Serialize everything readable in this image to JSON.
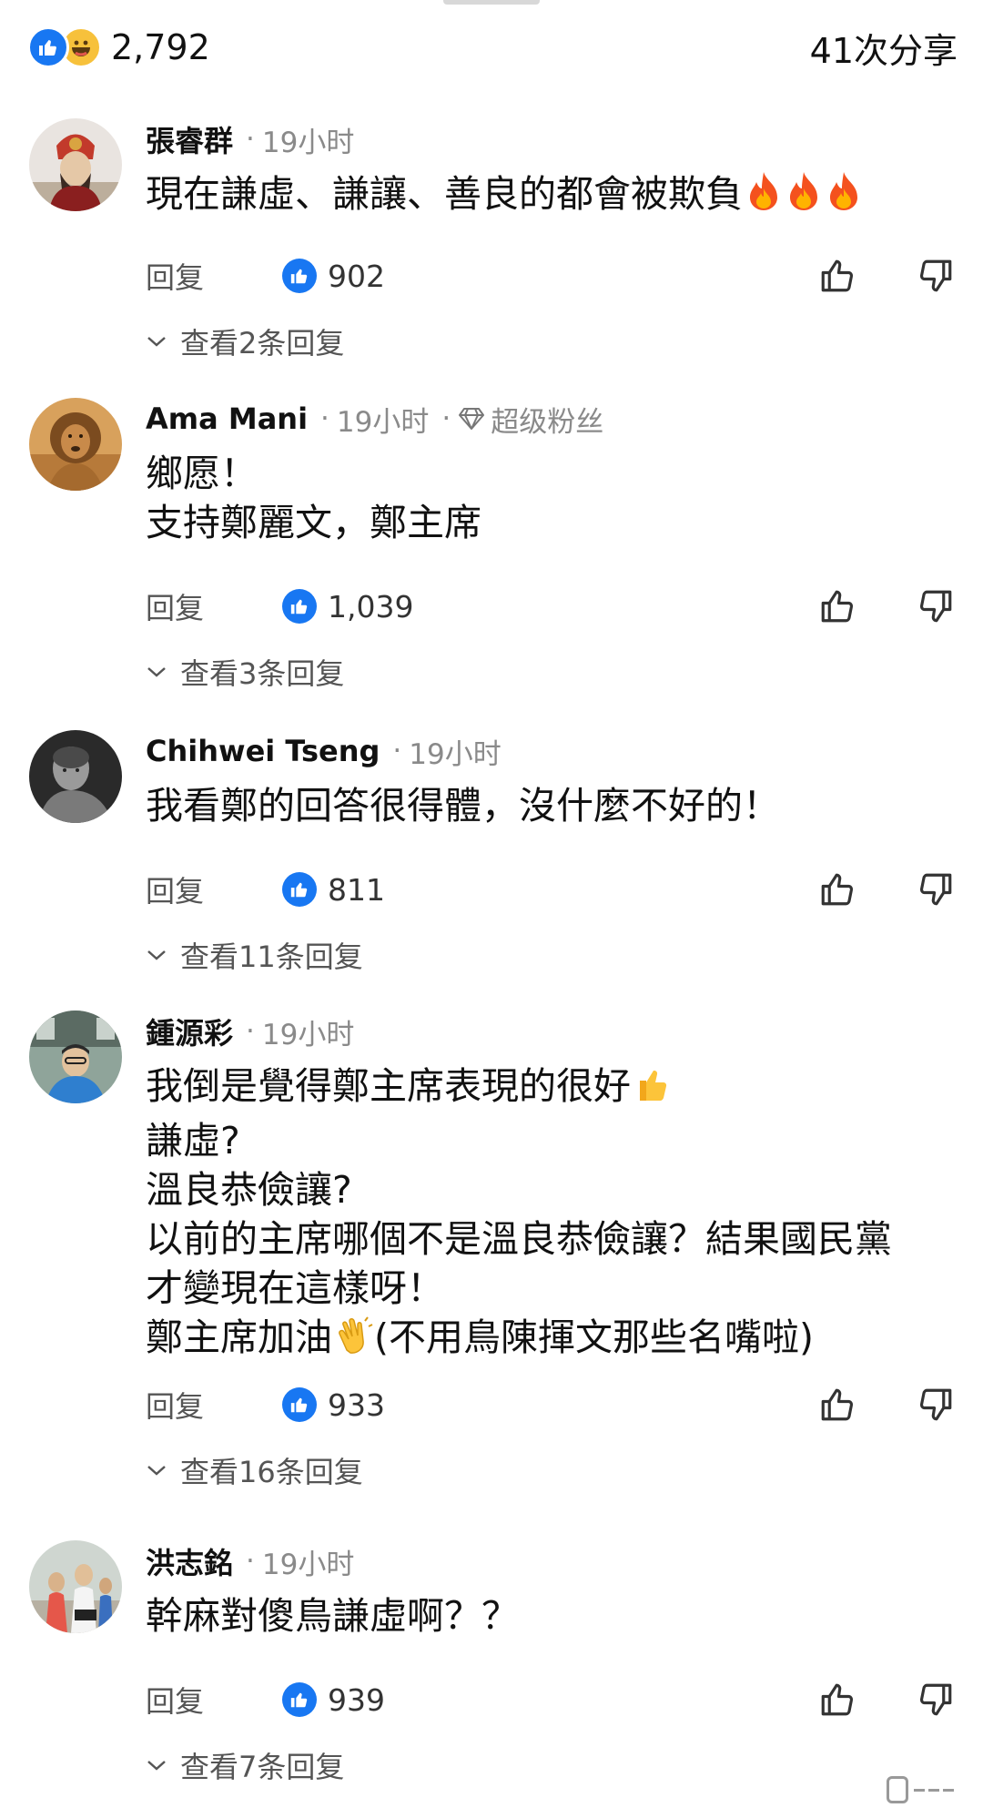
{
  "header": {
    "reaction_count": "2,792",
    "share_count": "41次分享",
    "reaction_icons": [
      "like-icon",
      "haha-icon"
    ]
  },
  "comments": [
    {
      "author": "張睿群",
      "time": "19小时",
      "badge": "",
      "text": "現在謙虛、謙讓、善良的都會被欺負",
      "emojis": [
        "fire",
        "fire",
        "fire"
      ],
      "reply_label": "回复",
      "likes": "902",
      "view_replies": "查看2条回复"
    },
    {
      "author": "Ama Mani",
      "time": "19小时",
      "badge": "超级粉丝",
      "text": "鄉愿！\n支持鄭麗文，鄭主席",
      "emojis": [],
      "reply_label": "回复",
      "likes": "1,039",
      "view_replies": "查看3条回复"
    },
    {
      "author": "Chihwei Tseng",
      "time": "19小时",
      "badge": "",
      "text": "我看鄭的回答很得體，沒什麼不好的！",
      "emojis": [],
      "reply_label": "回复",
      "likes": "811",
      "view_replies": "查看11条回复"
    },
    {
      "author": "鍾源彩",
      "time": "19小时",
      "badge": "",
      "text_lines": [
        "我倒是覺得鄭主席表現的很好",
        "謙虛?",
        "溫良恭儉讓?",
        "以前的主席哪個不是溫良恭儉讓？結果國民黨",
        "才變現在這樣呀！",
        "鄭主席加油",
        "(不用鳥陳揮文那些名嘴啦)"
      ],
      "emojis": [
        "thumbs-up",
        "clapping-hands"
      ],
      "reply_label": "回复",
      "likes": "933",
      "view_replies": "查看16条回复"
    },
    {
      "author": "洪志銘",
      "time": "19小时",
      "badge": "",
      "text": "幹麻對傻鳥謙虛啊？？",
      "emojis": [],
      "reply_label": "回复",
      "likes": "939",
      "view_replies": "查看7条回复"
    }
  ],
  "colors": {
    "like_blue": "#1877f2",
    "haha_yellow": "#f7c13b",
    "text_primary": "#111111",
    "text_secondary": "#8a8a8a"
  }
}
